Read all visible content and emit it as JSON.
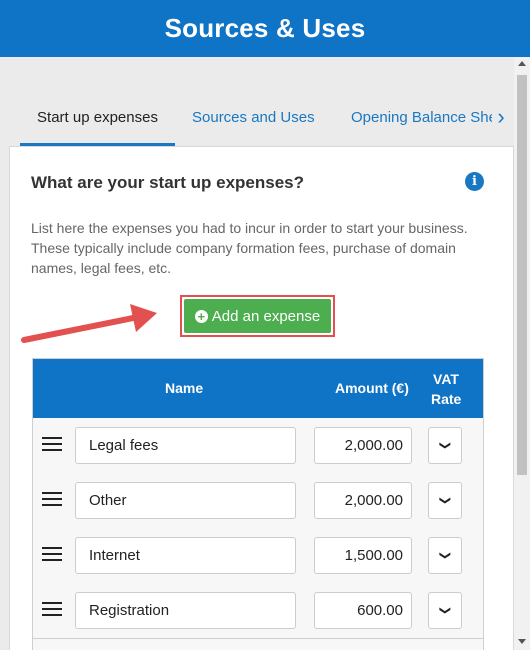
{
  "header": {
    "title": "Sources & Uses"
  },
  "tabs": [
    {
      "label": "Start up expenses",
      "active": true
    },
    {
      "label": "Sources and Uses",
      "active": false
    },
    {
      "label": "Opening Balance Sheet",
      "active": false
    }
  ],
  "card": {
    "title": "What are your start up expenses?",
    "info_icon": "info-icon",
    "description": "List here the expenses you had to incur in order to start your business. These typically include company formation fees, purchase of domain names, legal fees, etc.",
    "add_button_label": "Add an expense"
  },
  "table": {
    "headers": {
      "name": "Name",
      "amount": "Amount (€)",
      "vat_line1": "VAT",
      "vat_line2": "Rate"
    },
    "rows": [
      {
        "name": "Legal fees",
        "amount": "2,000.00"
      },
      {
        "name": "Other",
        "amount": "2,000.00"
      },
      {
        "name": "Internet",
        "amount": "1,500.00"
      },
      {
        "name": "Registration",
        "amount": "600.00"
      }
    ]
  },
  "colors": {
    "brand_blue": "#0f73c6",
    "button_green": "#4cae4f",
    "highlight_red": "#e2504f"
  }
}
